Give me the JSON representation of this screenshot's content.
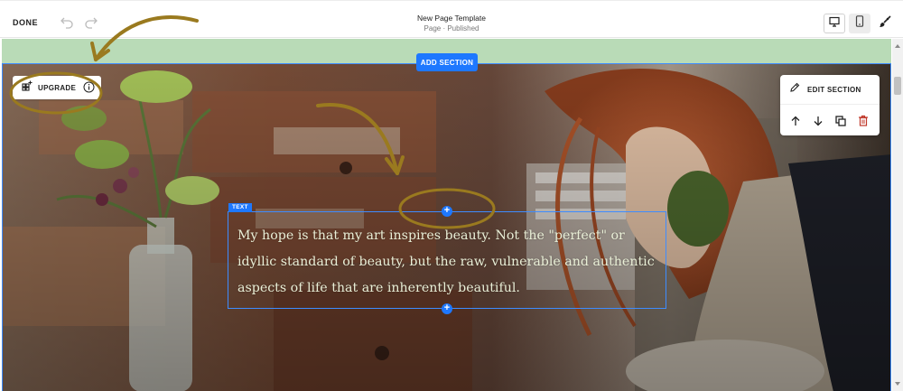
{
  "topbar": {
    "done_label": "DONE",
    "page_title": "New Page Template",
    "page_status": "Page · Published",
    "icons": [
      "undo-icon",
      "redo-icon",
      "desktop-icon",
      "mobile-icon",
      "paintbrush-icon"
    ]
  },
  "editor": {
    "add_section_label": "ADD SECTION",
    "upgrade_label": "UPGRADE",
    "edit_section_label": "EDIT SECTION",
    "text_block_tag": "TEXT",
    "text_block_content": "My hope is that my art inspires beauty. Not the \"perfect\" or idyllic standard of beauty, but the raw, vulnerable and authentic aspects of life that are inherently beautiful.",
    "accent_color": "#1e78ff",
    "annotation_color": "#9a7a1f"
  }
}
